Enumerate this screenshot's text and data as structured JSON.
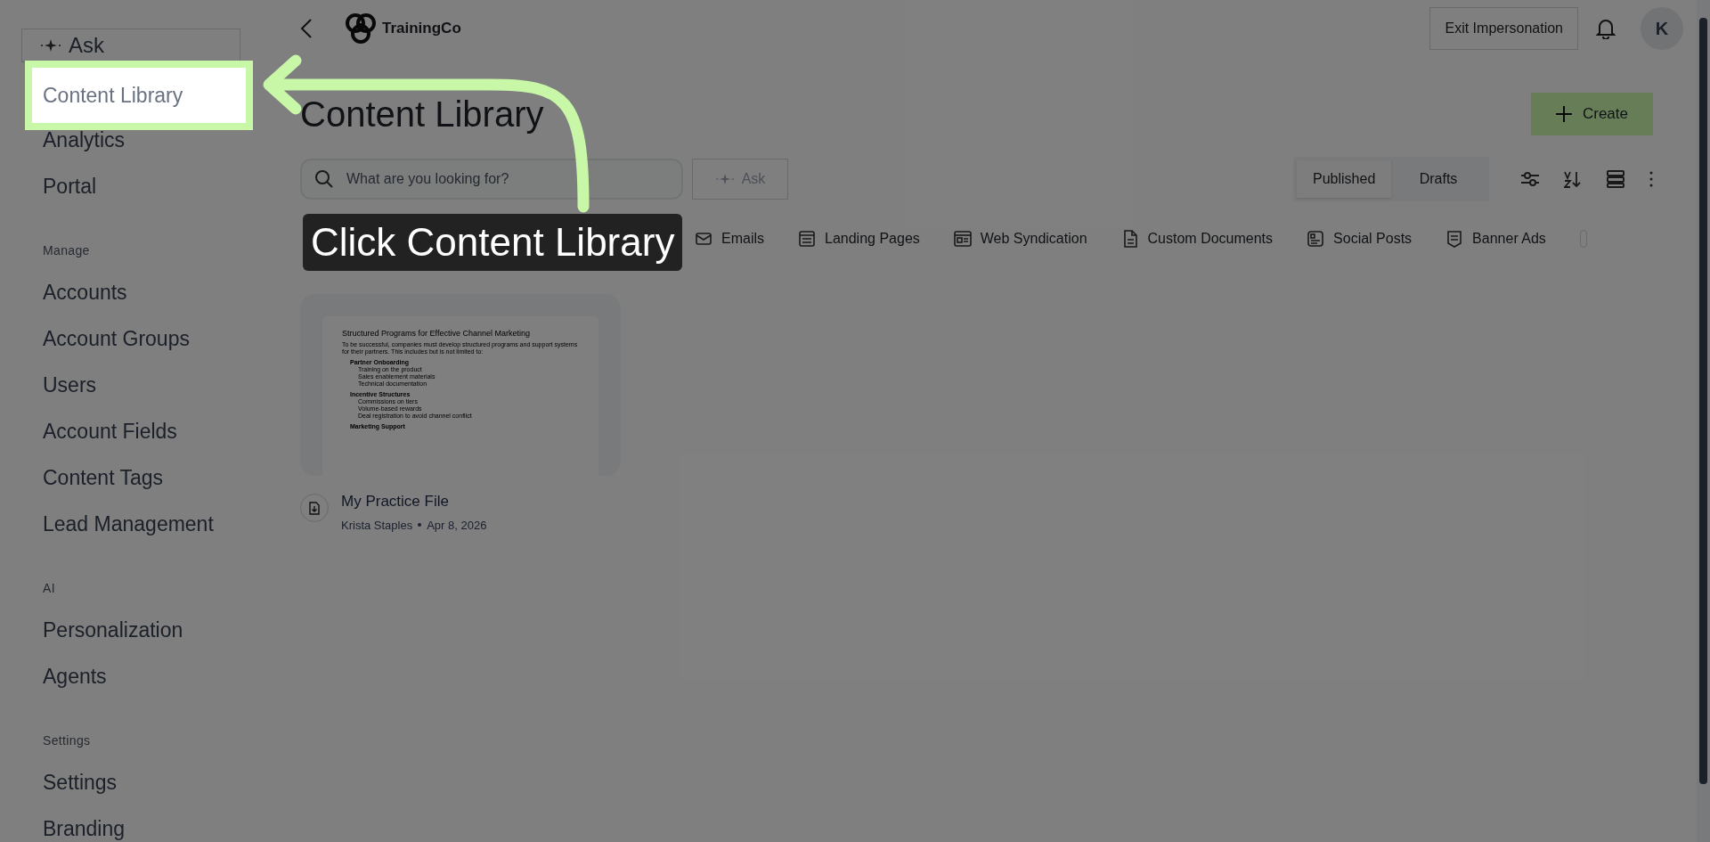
{
  "sidebar": {
    "ask_button": "Ask",
    "groups": [
      {
        "items": [
          {
            "label": "Content Library",
            "highlighted": true
          },
          {
            "label": "Analytics",
            "highlighted": false
          },
          {
            "label": "Portal",
            "highlighted": false
          }
        ]
      },
      {
        "heading": "Manage",
        "items": [
          {
            "label": "Accounts",
            "highlighted": false
          },
          {
            "label": "Account Groups",
            "highlighted": false
          },
          {
            "label": "Users",
            "highlighted": false
          },
          {
            "label": "Account Fields",
            "highlighted": false
          },
          {
            "label": "Content Tags",
            "highlighted": false
          },
          {
            "label": "Lead Management",
            "highlighted": false
          }
        ]
      },
      {
        "heading": "AI",
        "items": [
          {
            "label": "Personalization",
            "highlighted": false
          },
          {
            "label": "Agents",
            "highlighted": false
          }
        ]
      },
      {
        "heading": "Settings",
        "items": [
          {
            "label": "Settings",
            "highlighted": false
          },
          {
            "label": "Branding",
            "highlighted": false
          }
        ]
      }
    ]
  },
  "header": {
    "logo_text": "TrainingCo",
    "exit_button": "Exit Impersonation",
    "avatar": "K"
  },
  "page": {
    "title": "Content Library",
    "create_button": "Create",
    "search": {
      "placeholder": "What are you looking for?"
    },
    "ask_button": "Ask",
    "status_tabs": [
      {
        "label": "Published",
        "selected": true
      },
      {
        "label": "Drafts",
        "selected": false
      }
    ],
    "categories": [
      {
        "kind": "email",
        "label": "Emails"
      },
      {
        "kind": "landing",
        "label": "Landing Pages"
      },
      {
        "kind": "syndication",
        "label": "Web Syndication"
      },
      {
        "kind": "document",
        "label": "Custom Documents"
      },
      {
        "kind": "social",
        "label": "Social Posts"
      },
      {
        "kind": "banner",
        "label": "Banner Ads"
      }
    ],
    "cards": [
      {
        "title": "My Practice File",
        "author": "Krista Staples",
        "date": "Apr 8, 2026",
        "preview": {
          "title": "Structured Programs for Effective Channel Marketing",
          "intro": "To be successful, companies must develop structured programs and support systems for their partners. This includes but is not limited to:",
          "sections": [
            {
              "heading": "Partner Onboarding",
              "bullets": [
                "Training on the product",
                "Sales enablement materials",
                "Technical documentation"
              ]
            },
            {
              "heading": "Incentive Structures",
              "bullets": [
                "Commissions on tiers",
                "Volume-based rewards",
                "Deal registration to avoid channel conflict"
              ]
            },
            {
              "heading": "Marketing Support"
            }
          ]
        }
      }
    ]
  },
  "callout": {
    "text": "Click Content Library"
  }
}
